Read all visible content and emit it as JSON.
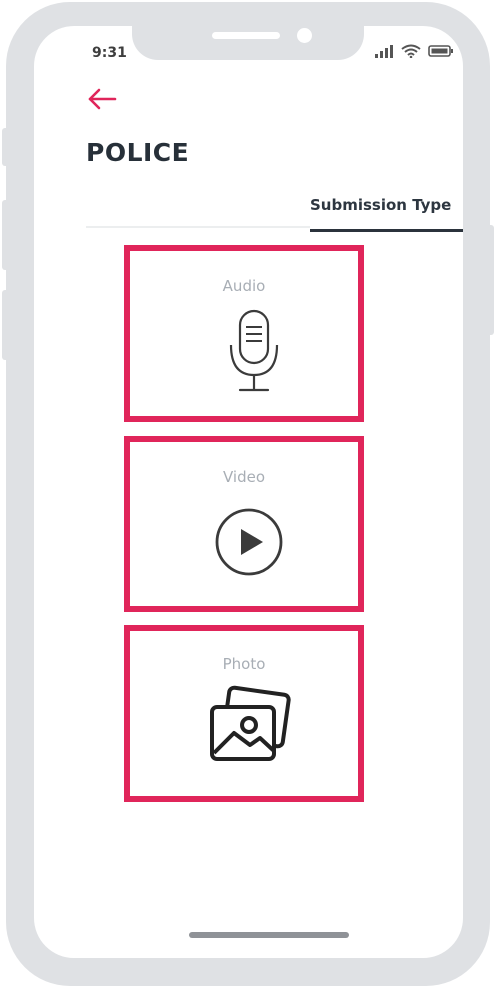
{
  "status_bar": {
    "time": "9:31",
    "icons": [
      "signal-icon",
      "wifi-icon",
      "battery-icon"
    ]
  },
  "header": {
    "back_icon": "back-arrow-icon",
    "title": "POLICE"
  },
  "tabs": {
    "active_label": "Submission Type"
  },
  "submission_options": [
    {
      "label": "Audio",
      "icon": "microphone-icon"
    },
    {
      "label": "Video",
      "icon": "play-icon"
    },
    {
      "label": "Photo",
      "icon": "photos-icon"
    }
  ],
  "colors": {
    "accent": "#e0255a",
    "title": "#273039",
    "muted_label": "#a8aeb5",
    "frame": "#dfe1e4"
  }
}
